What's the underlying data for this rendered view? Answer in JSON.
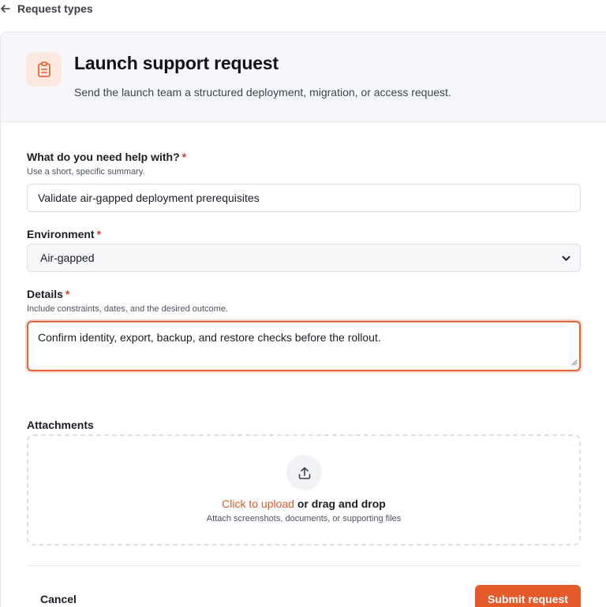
{
  "back_link": {
    "label": "Request types"
  },
  "header": {
    "icon": "clipboard-icon",
    "title": "Launch support request",
    "subtitle": "Send the launch team a structured deployment, migration, or access request."
  },
  "form": {
    "summary": {
      "label": "What do you need help with?",
      "required_mark": "*",
      "hint": "Use a short, specific summary.",
      "value": "Validate air-gapped deployment prerequisites"
    },
    "environment": {
      "label": "Environment",
      "required_mark": "*",
      "selected": "Air-gapped"
    },
    "details": {
      "label": "Details",
      "required_mark": "*",
      "hint": "Include constraints, dates, and the desired outcome.",
      "value": "Confirm identity, export, backup, and restore checks before the rollout."
    },
    "attachments": {
      "label": "Attachments",
      "icon": "upload-icon",
      "link_text": "Click to upload",
      "rest_text": " or drag and drop",
      "hint": "Attach screenshots, documents, or supporting files"
    }
  },
  "actions": {
    "cancel": "Cancel",
    "submit": "Submit request"
  },
  "colors": {
    "accent": "#e55a2b",
    "required": "#dc3b2f",
    "icon_bg": "#fde8df"
  }
}
